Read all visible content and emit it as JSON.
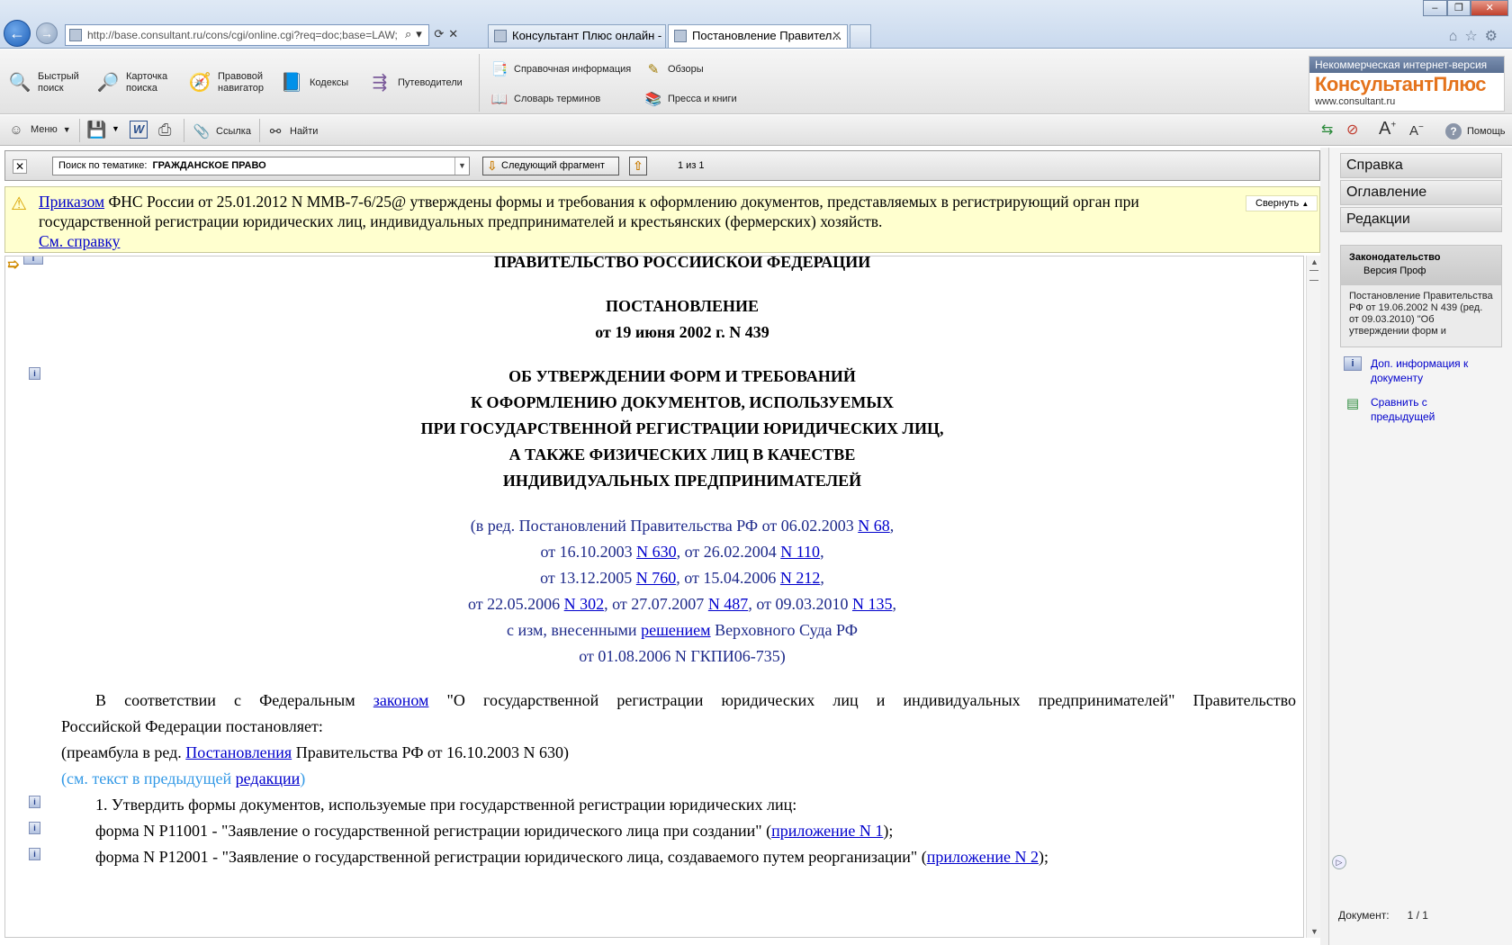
{
  "browser": {
    "url": "http://base.consultant.ru/cons/cgi/online.cgi?req=doc;base=LAW;",
    "tabs": [
      {
        "label": "Консультант Плюс онлайн - ..."
      },
      {
        "label": "Постановление Правител..."
      }
    ]
  },
  "toolbar": {
    "items": [
      {
        "label": "Быстрый\nпоиск",
        "icon": "magnifier-icon"
      },
      {
        "label": "Карточка\nпоиска",
        "icon": "search-card-icon"
      },
      {
        "label": "Правовой\nнавигатор",
        "icon": "compass-icon"
      },
      {
        "label": "Кодексы",
        "icon": "codex-book-icon"
      },
      {
        "label": "Путеводители",
        "icon": "signpost-icon"
      }
    ],
    "col2": [
      {
        "label": "Справочная информация",
        "icon": "reference-icon"
      },
      {
        "label": "Словарь терминов",
        "icon": "dictionary-icon"
      }
    ],
    "col3": [
      {
        "label": "Обзоры",
        "icon": "pen-icon"
      },
      {
        "label": "Пресса и книги",
        "icon": "books-icon"
      }
    ]
  },
  "logo": {
    "top": "Некоммерческая интернет-версия",
    "brand": "КонсультантПлюс",
    "url": "www.consultant.ru"
  },
  "toolbar2": {
    "menu": "Меню",
    "link": "Ссылка",
    "find": "Найти",
    "help": "Помощь"
  },
  "search": {
    "prefix": "Поиск по тематике:",
    "topic": "ГРАЖДАНСКОЕ ПРАВО",
    "next": "Следующий фрагмент",
    "count": "1 из 1"
  },
  "warning": {
    "link1": "Приказом",
    "text": " ФНС России от 25.01.2012 N ММВ-7-6/25@ утверждены формы и требования к оформлению документов, представляемых в регистрирующий орган при государственной регистрации юридических лиц, индивидуальных предпринимателей и крестьянских (фермерских) хозяйств.",
    "link2": "См. справку",
    "collapse": "Свернуть"
  },
  "doc": {
    "gov": "ПРАВИТЕЛЬСТВО РОССИЙСКОЙ ФЕДЕРАЦИИ",
    "type": "ПОСТАНОВЛЕНИЕ",
    "date": "от 19 июня 2002 г. N 439",
    "title": [
      "ОБ УТВЕРЖДЕНИИ ФОРМ И ТРЕБОВАНИЙ",
      "К ОФОРМЛЕНИЮ ДОКУМЕНТОВ, ИСПОЛЬЗУЕМЫХ",
      "ПРИ ГОСУДАРСТВЕННОЙ РЕГИСТРАЦИИ ЮРИДИЧЕСКИХ ЛИЦ,",
      "А ТАКЖЕ ФИЗИЧЕСКИХ ЛИЦ В КАЧЕСТВЕ",
      "ИНДИВИДУАЛЬНЫХ ПРЕДПРИНИМАТЕЛЕЙ"
    ],
    "ed": {
      "l1a": "(в ред. Постановлений Правительства РФ от 06.02.2003 ",
      "l1b": "N 68",
      "l1c": ",",
      "l2a": "от 16.10.2003 ",
      "l2b": "N 630",
      "l2c": ", от 26.02.2004 ",
      "l2d": "N 110",
      "l2e": ",",
      "l3a": "от 13.12.2005 ",
      "l3b": "N 760",
      "l3c": ", от 15.04.2006 ",
      "l3d": "N 212",
      "l3e": ",",
      "l4a": "от 22.05.2006 ",
      "l4b": "N 302",
      "l4c": ", от 27.07.2007 ",
      "l4d": "N 487",
      "l4e": ", от 09.03.2010 ",
      "l4f": "N 135",
      "l4g": ",",
      "l5a": "с изм, внесенными ",
      "l5b": "решением",
      "l5c": " Верховного Суда РФ",
      "l6": "от 01.08.2006 N ГКПИ06-735)"
    },
    "preamble": {
      "a": "В соответствии с Федеральным ",
      "b": "законом",
      "c": " \"О государственной регистрации юридических лиц и индивидуальных предпринимателей\" Правительство",
      "d": "Российской Федерации постановляет:"
    },
    "pre_ed": {
      "a": "(преамбула в ред. ",
      "b": "Постановления",
      "c": " Правительства РФ от 16.10.2003 N 630)"
    },
    "prev": {
      "a": "(см. текст в предыдущей ",
      "b": "редакции",
      "c": ")"
    },
    "item1": "1. Утвердить формы документов, используемые при государственной регистрации юридических лиц:",
    "f1": {
      "a": "форма N Р11001 - \"Заявление о государственной регистрации юридического лица при создании\" (",
      "b": "приложение N 1",
      "c": ");"
    },
    "f2": {
      "a": "форма N Р12001 - \"Заявление о государственной регистрации юридического лица, создаваемого путем реорганизации\" (",
      "b": "приложение N 2",
      "c": ");"
    }
  },
  "right": {
    "tabs": [
      "Справка",
      "Оглавление",
      "Редакции"
    ],
    "info_head": "Законодательство",
    "info_sub": "Версия Проф",
    "info_body": "Постановление Правительства РФ от 19.06.2002 N 439 (ред. от 09.03.2010) \"Об утверждении форм и",
    "link1": "Доп. информация к документу",
    "link2": "Сравнить с предыдущей",
    "doc_label": "Документ:",
    "doc_count": "1 / 1"
  }
}
